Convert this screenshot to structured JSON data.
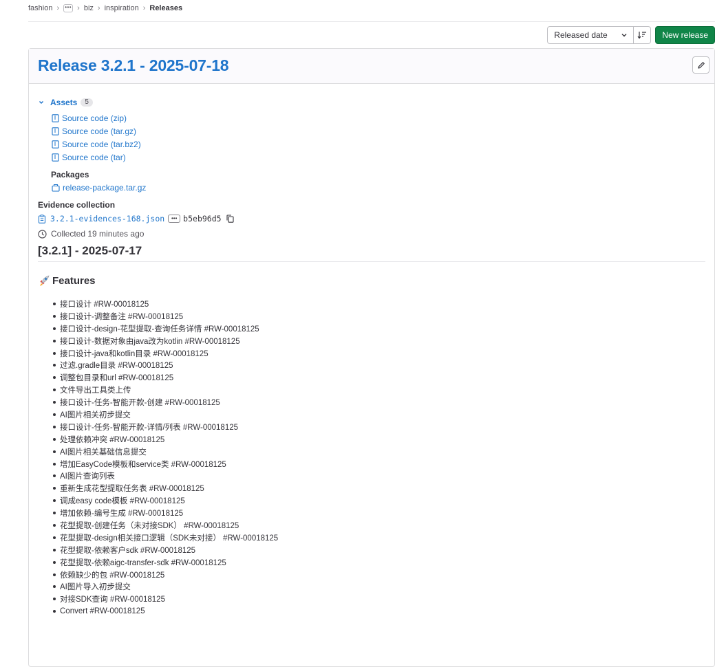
{
  "breadcrumb": {
    "items": [
      "fashion",
      "biz",
      "inspiration"
    ],
    "more": "•••",
    "current": "Releases"
  },
  "toolbar": {
    "sort_value": "Released date",
    "new_release": "New release"
  },
  "release": {
    "title": "Release 3.2.1 - 2025-07-18",
    "assets_label": "Assets",
    "assets_count": "5",
    "sources": [
      "Source code (zip)",
      "Source code (tar.gz)",
      "Source code (tar.bz2)",
      "Source code (tar)"
    ],
    "packages_label": "Packages",
    "package": "release-package.tar.gz",
    "evidence_label": "Evidence collection",
    "evidence_file": "3.2.1-evidences-168.json",
    "evidence_more": "•••",
    "evidence_sha": "b5eb96d5",
    "collected": "Collected 19 minutes ago",
    "version_heading": "[3.2.1] - 2025-07-17",
    "features_heading": "Features",
    "features": [
      "接口设计 #RW-00018125",
      "接口设计-调整备注 #RW-00018125",
      "接口设计-design-花型提取-查询任务详情 #RW-00018125",
      "接口设计-数据对象由java改为kotlin #RW-00018125",
      "接口设计-java和kotlin目录 #RW-00018125",
      "过滤.gradle目录 #RW-00018125",
      "调整包目录和url #RW-00018125",
      "文件导出工具类上传",
      "接口设计-任务-智能开款-创建 #RW-00018125",
      "AI图片相关初步提交",
      "接口设计-任务-智能开款-详情/列表 #RW-00018125",
      "处理依赖冲突 #RW-00018125",
      "AI图片相关基础信息提交",
      "增加EasyCode模板和service类 #RW-00018125",
      "AI图片查询列表",
      "重新生成花型提取任务表 #RW-00018125",
      "调成easy code模板 #RW-00018125",
      "增加依赖-编号生成 #RW-00018125",
      "花型提取-创建任务（未对接SDK） #RW-00018125",
      "花型提取-design相关接口逻辑（SDK未对接） #RW-00018125",
      "花型提取-依赖客户sdk #RW-00018125",
      "花型提取-依赖aigc-transfer-sdk #RW-00018125",
      "依赖缺少的包 #RW-00018125",
      "AI图片导入初步提交",
      "对接SDK查询 #RW-00018125",
      "Convert #RW-00018125"
    ]
  },
  "colors": {
    "link": "#1f75cb",
    "primary_button": "#108548"
  },
  "icons": [
    "chevron-right-icon",
    "chevron-down-icon",
    "sort-icon",
    "pencil-icon",
    "file-zip-icon",
    "package-icon",
    "clipboard-icon",
    "copy-icon",
    "clock-icon",
    "rocket-icon"
  ]
}
